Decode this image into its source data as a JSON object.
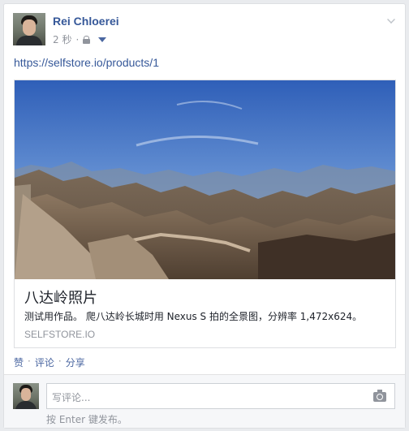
{
  "post": {
    "author": "Rei Chloerei",
    "time": "2 秒",
    "dot": "·",
    "link_text": "https://selfstore.io/products/1",
    "privacy_icon": "lock-icon",
    "audience_icon": "caret-down-icon",
    "options_icon": "chevron-down-icon"
  },
  "preview": {
    "title": "八达岭照片",
    "description": "测试用作品。 爬八达岭长城时用 Nexus S 拍的全景图，分辨率 1,472x624。",
    "domain": "SELFSTORE.IO"
  },
  "actions": {
    "like": "赞",
    "comment": "评论",
    "share": "分享",
    "sep": "·"
  },
  "comment": {
    "placeholder": "写评论...",
    "hint": "按 Enter 键发布。",
    "camera_icon": "camera-icon"
  }
}
